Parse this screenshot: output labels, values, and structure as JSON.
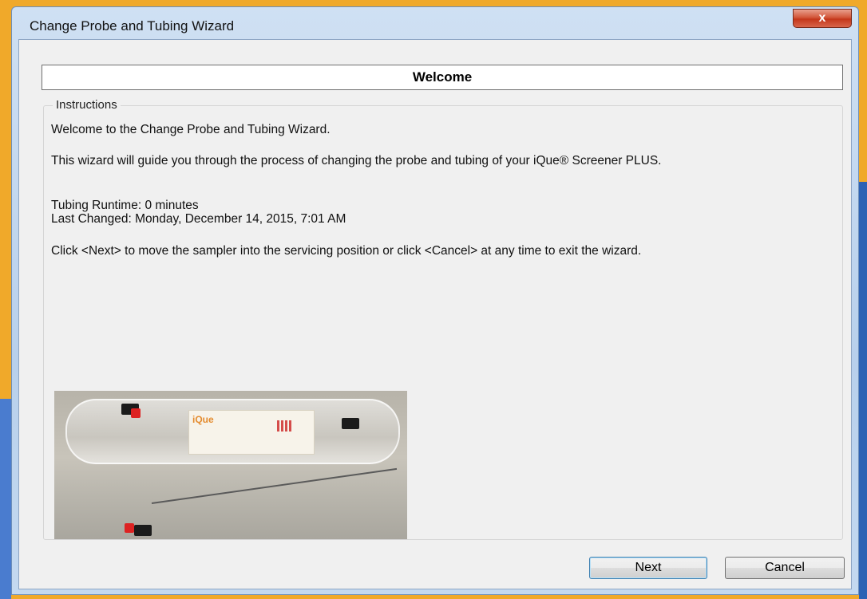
{
  "window": {
    "title": "Change Probe and Tubing Wizard",
    "close_glyph": "x"
  },
  "header": {
    "title": "Welcome"
  },
  "instructions": {
    "group_label": "Instructions",
    "line1": "Welcome to the Change Probe and Tubing Wizard.",
    "line2": "This wizard will guide you through the process of changing the probe and tubing of your iQue® Screener PLUS.",
    "runtime": "Tubing Runtime: 0 minutes",
    "last_changed": "Last Changed: Monday, December 14, 2015, 7:01 AM",
    "line3": "Click <Next> to move the sampler into the servicing position or click <Cancel> at any time to exit the wizard."
  },
  "photo": {
    "brand_text": "iQue"
  },
  "buttons": {
    "next": "Next",
    "cancel": "Cancel"
  },
  "colors": {
    "desktop_accent": "#f0a92a",
    "close_button": "#c4371b",
    "title_bar": "#b8d0ec"
  }
}
